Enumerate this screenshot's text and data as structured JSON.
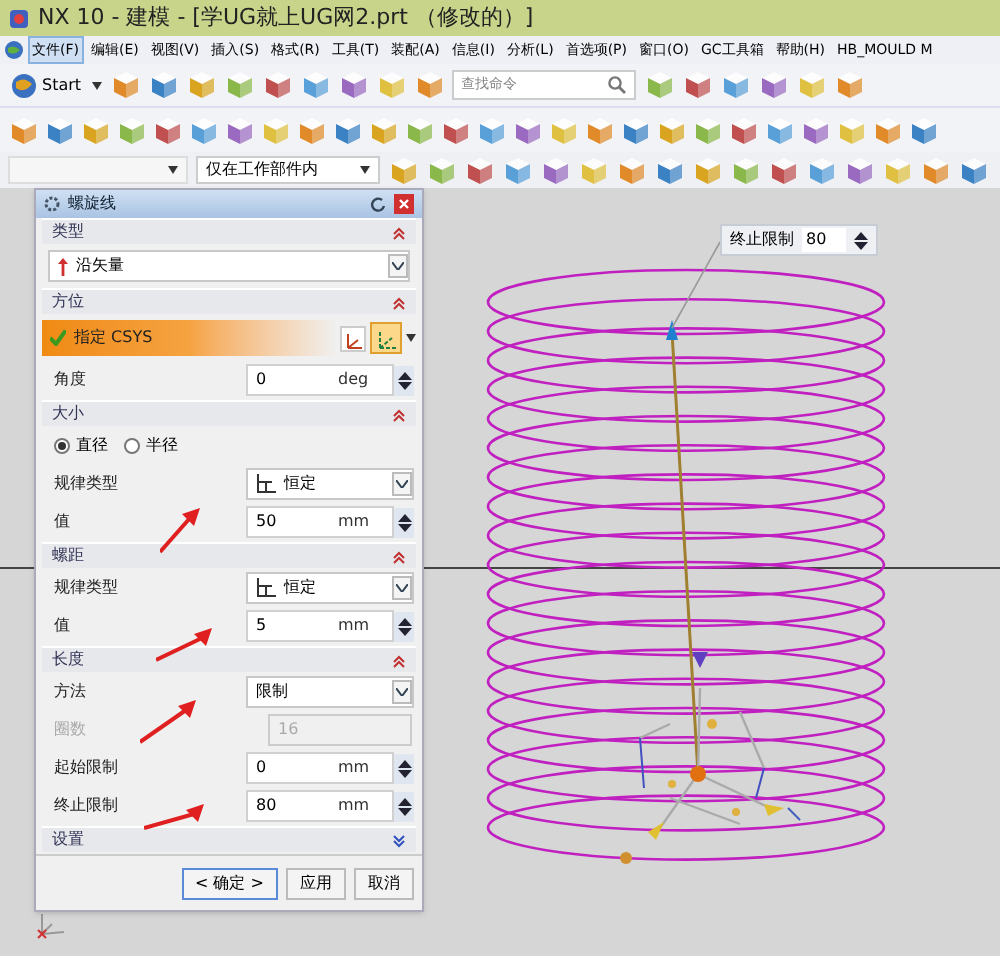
{
  "window": {
    "title": "NX 10 - 建模 - [学UG就上UG网2.prt （修改的）]"
  },
  "menu": [
    {
      "label": "文件(F)",
      "selected": true
    },
    {
      "label": "编辑(E)",
      "selected": false
    },
    {
      "label": "视图(V)",
      "selected": false
    },
    {
      "label": "插入(S)",
      "selected": false
    },
    {
      "label": "格式(R)",
      "selected": false
    },
    {
      "label": "工具(T)",
      "selected": false
    },
    {
      "label": "装配(A)",
      "selected": false
    },
    {
      "label": "信息(I)",
      "selected": false
    },
    {
      "label": "分析(L)",
      "selected": false
    },
    {
      "label": "首选项(P)",
      "selected": false
    },
    {
      "label": "窗口(O)",
      "selected": false
    },
    {
      "label": "GC工具箱",
      "selected": false
    },
    {
      "label": "帮助(H)",
      "selected": false
    },
    {
      "label": "HB_MOULD M",
      "selected": false
    }
  ],
  "toolbar": {
    "start": "Start",
    "search": {
      "placeholder": "查找命令"
    }
  },
  "selection_bar": {
    "filter": "仅在工作部件内"
  },
  "dialog": {
    "title": "螺旋线",
    "sections": [
      {
        "title": "类型",
        "expanded": true,
        "rows": [
          {
            "kind": "select",
            "value": "沿矢量"
          }
        ]
      },
      {
        "title": "方位",
        "expanded": true,
        "rows": [
          {
            "kind": "csys",
            "value": "指定 CSYS"
          },
          {
            "kind": "number",
            "label": "角度",
            "value": "0",
            "unit": "deg"
          }
        ]
      },
      {
        "title": "大小",
        "expanded": true,
        "rows": [
          {
            "kind": "radio",
            "options": [
              {
                "label": "直径",
                "selected": true
              },
              {
                "label": "半径",
                "selected": false
              }
            ]
          },
          {
            "kind": "law",
            "label": "规律类型",
            "value": "恒定"
          },
          {
            "kind": "number",
            "label": "值",
            "value": "50",
            "unit": "mm"
          }
        ]
      },
      {
        "title": "螺距",
        "expanded": true,
        "rows": [
          {
            "kind": "law",
            "label": "规律类型",
            "value": "恒定"
          },
          {
            "kind": "number",
            "label": "值",
            "value": "5",
            "unit": "mm"
          }
        ]
      },
      {
        "title": "长度",
        "expanded": true,
        "rows": [
          {
            "kind": "choice",
            "label": "方法",
            "value": "限制"
          },
          {
            "kind": "readonly",
            "label": "圈数",
            "value": "16"
          },
          {
            "kind": "number",
            "label": "起始限制",
            "value": "0",
            "unit": "mm"
          },
          {
            "kind": "number",
            "label": "终止限制",
            "value": "80",
            "unit": "mm"
          }
        ]
      },
      {
        "title": "设置",
        "expanded": false
      }
    ],
    "buttons": [
      {
        "label": "< 确定 >",
        "default": true
      },
      {
        "label": "应用",
        "default": false
      },
      {
        "label": "取消",
        "default": false
      }
    ]
  },
  "canvas": {
    "tooltip": {
      "label": "终止限制",
      "value": "80"
    }
  }
}
